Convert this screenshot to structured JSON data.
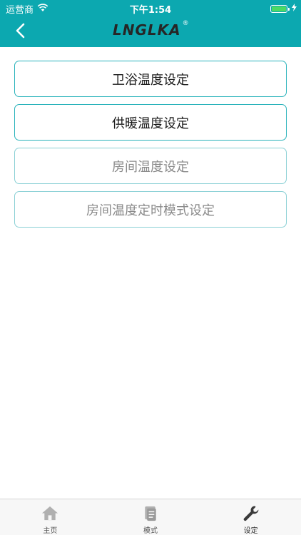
{
  "status_bar": {
    "carrier": "运营商",
    "time": "下午1:54",
    "battery_level": 1.0,
    "battery_color": "#4cd964"
  },
  "header": {
    "logo_text": "LNGLKA",
    "logo_mark": "®",
    "background_color": "#0ca8b0",
    "back_icon": "chevron-left-icon"
  },
  "menu": {
    "items": [
      {
        "label": "卫浴温度设定",
        "enabled": true
      },
      {
        "label": "供暖温度设定",
        "enabled": true
      },
      {
        "label": "房间温度设定",
        "enabled": false
      },
      {
        "label": "房间温度定时模式设定",
        "enabled": false
      }
    ],
    "border_color": "#2ab3bb"
  },
  "tab_bar": {
    "tabs": [
      {
        "label": "主页",
        "icon": "home-icon"
      },
      {
        "label": "模式",
        "icon": "document-icon"
      },
      {
        "label": "设定",
        "icon": "wrench-icon",
        "active": true
      }
    ]
  }
}
